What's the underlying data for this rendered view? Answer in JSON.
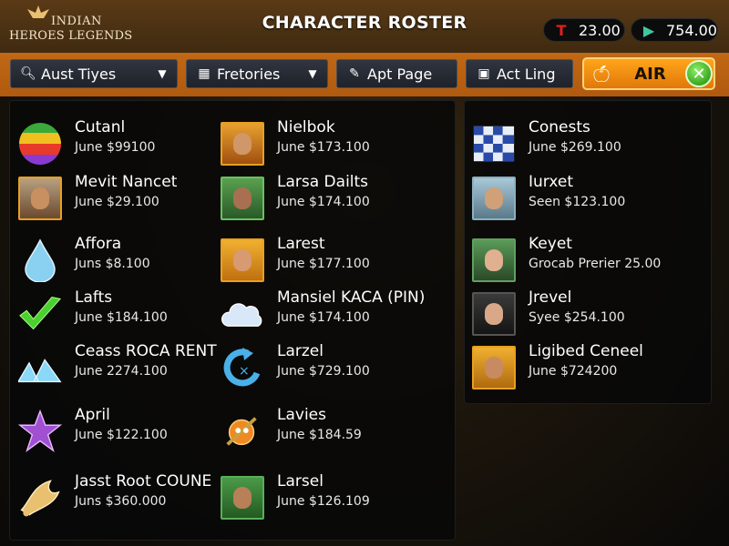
{
  "header": {
    "logo_line1": "INDIAN",
    "logo_line2": "HEROES LEGENDS",
    "title": "CHARACTER ROSTER",
    "currencies": [
      {
        "icon": "t-coin-icon",
        "glyph": "T",
        "value": "23.00",
        "color": "#e02020"
      },
      {
        "icon": "play-gem-icon",
        "glyph": "▶",
        "value": "754.00",
        "color": "#3ec8a0"
      }
    ]
  },
  "filters": {
    "filter1": {
      "icon": "search-icon",
      "label": "Aust Tiyes"
    },
    "filter2": {
      "icon": "grid-icon",
      "label": "Fretories"
    },
    "filter3": {
      "icon": "pencil-icon",
      "label": "Apt Page"
    },
    "filter4": {
      "icon": "list-box-icon",
      "label": "Act Ling"
    },
    "air_button": {
      "label": "AIR"
    }
  },
  "roster": {
    "left_col1": [
      {
        "name": "Cutanl",
        "price": "June $99100",
        "thumb": "rainbow-orb-icon"
      },
      {
        "name": "Mevit Nancet",
        "price": "June $29.100",
        "thumb": "hero-portrait"
      },
      {
        "name": "Affora",
        "price": "Juns $8.100",
        "thumb": "water-drop-icon"
      },
      {
        "name": "Lafts",
        "price": "June $184.100",
        "thumb": "checkmark-icon"
      },
      {
        "name": "Ceass ROCA RENT",
        "price": "June 2274.100",
        "thumb": "mountains-icon"
      },
      {
        "name": "April",
        "price": "June $122.100",
        "thumb": "star-icon"
      },
      {
        "name": "Jasst Root COUNE",
        "price": "Juns $360.000",
        "thumb": "golden-claw-icon"
      }
    ],
    "left_col2": [
      {
        "name": "Nielbok",
        "price": "June $173.100",
        "thumb": "hero-portrait"
      },
      {
        "name": "Larsa Dailts",
        "price": "June $174.100",
        "thumb": "hero-portrait"
      },
      {
        "name": "Larest",
        "price": "June $177.100",
        "thumb": "hero-portrait"
      },
      {
        "name": "Mansiel KACA (PIN)",
        "price": "June $174.100",
        "thumb": "cloud-icon"
      },
      {
        "name": "Larzel",
        "price": "June $729.100",
        "thumb": "refresh-arrow-icon"
      },
      {
        "name": "Lavies",
        "price": "June $184.59",
        "thumb": "creature-icon"
      },
      {
        "name": "Larsel",
        "price": "June $126.109",
        "thumb": "hero-portrait"
      }
    ],
    "right_col": [
      {
        "name": "Conests",
        "price": "June $269.100",
        "thumb": "checkered-flag-icon"
      },
      {
        "name": "Iurxet",
        "price": "Seen $123.100",
        "thumb": "hero-portrait"
      },
      {
        "name": "Keyet",
        "price": "Grocab Prerier 25.00",
        "thumb": "hero-portrait"
      },
      {
        "name": "Jrevel",
        "price": "Syee $254.100",
        "thumb": "hero-portrait"
      },
      {
        "name": "Ligibed Ceneel",
        "price": "June $724200",
        "thumb": "hero-portrait"
      }
    ]
  }
}
